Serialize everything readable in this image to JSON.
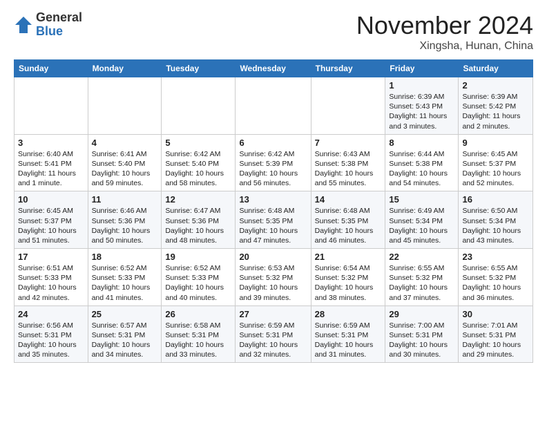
{
  "header": {
    "logo_general": "General",
    "logo_blue": "Blue",
    "month_title": "November 2024",
    "location": "Xingsha, Hunan, China"
  },
  "weekdays": [
    "Sunday",
    "Monday",
    "Tuesday",
    "Wednesday",
    "Thursday",
    "Friday",
    "Saturday"
  ],
  "weeks": [
    [
      {
        "day": "",
        "info": ""
      },
      {
        "day": "",
        "info": ""
      },
      {
        "day": "",
        "info": ""
      },
      {
        "day": "",
        "info": ""
      },
      {
        "day": "",
        "info": ""
      },
      {
        "day": "1",
        "info": "Sunrise: 6:39 AM\nSunset: 5:43 PM\nDaylight: 11 hours and 3 minutes."
      },
      {
        "day": "2",
        "info": "Sunrise: 6:39 AM\nSunset: 5:42 PM\nDaylight: 11 hours and 2 minutes."
      }
    ],
    [
      {
        "day": "3",
        "info": "Sunrise: 6:40 AM\nSunset: 5:41 PM\nDaylight: 11 hours and 1 minute."
      },
      {
        "day": "4",
        "info": "Sunrise: 6:41 AM\nSunset: 5:40 PM\nDaylight: 10 hours and 59 minutes."
      },
      {
        "day": "5",
        "info": "Sunrise: 6:42 AM\nSunset: 5:40 PM\nDaylight: 10 hours and 58 minutes."
      },
      {
        "day": "6",
        "info": "Sunrise: 6:42 AM\nSunset: 5:39 PM\nDaylight: 10 hours and 56 minutes."
      },
      {
        "day": "7",
        "info": "Sunrise: 6:43 AM\nSunset: 5:38 PM\nDaylight: 10 hours and 55 minutes."
      },
      {
        "day": "8",
        "info": "Sunrise: 6:44 AM\nSunset: 5:38 PM\nDaylight: 10 hours and 54 minutes."
      },
      {
        "day": "9",
        "info": "Sunrise: 6:45 AM\nSunset: 5:37 PM\nDaylight: 10 hours and 52 minutes."
      }
    ],
    [
      {
        "day": "10",
        "info": "Sunrise: 6:45 AM\nSunset: 5:37 PM\nDaylight: 10 hours and 51 minutes."
      },
      {
        "day": "11",
        "info": "Sunrise: 6:46 AM\nSunset: 5:36 PM\nDaylight: 10 hours and 50 minutes."
      },
      {
        "day": "12",
        "info": "Sunrise: 6:47 AM\nSunset: 5:36 PM\nDaylight: 10 hours and 48 minutes."
      },
      {
        "day": "13",
        "info": "Sunrise: 6:48 AM\nSunset: 5:35 PM\nDaylight: 10 hours and 47 minutes."
      },
      {
        "day": "14",
        "info": "Sunrise: 6:48 AM\nSunset: 5:35 PM\nDaylight: 10 hours and 46 minutes."
      },
      {
        "day": "15",
        "info": "Sunrise: 6:49 AM\nSunset: 5:34 PM\nDaylight: 10 hours and 45 minutes."
      },
      {
        "day": "16",
        "info": "Sunrise: 6:50 AM\nSunset: 5:34 PM\nDaylight: 10 hours and 43 minutes."
      }
    ],
    [
      {
        "day": "17",
        "info": "Sunrise: 6:51 AM\nSunset: 5:33 PM\nDaylight: 10 hours and 42 minutes."
      },
      {
        "day": "18",
        "info": "Sunrise: 6:52 AM\nSunset: 5:33 PM\nDaylight: 10 hours and 41 minutes."
      },
      {
        "day": "19",
        "info": "Sunrise: 6:52 AM\nSunset: 5:33 PM\nDaylight: 10 hours and 40 minutes."
      },
      {
        "day": "20",
        "info": "Sunrise: 6:53 AM\nSunset: 5:32 PM\nDaylight: 10 hours and 39 minutes."
      },
      {
        "day": "21",
        "info": "Sunrise: 6:54 AM\nSunset: 5:32 PM\nDaylight: 10 hours and 38 minutes."
      },
      {
        "day": "22",
        "info": "Sunrise: 6:55 AM\nSunset: 5:32 PM\nDaylight: 10 hours and 37 minutes."
      },
      {
        "day": "23",
        "info": "Sunrise: 6:55 AM\nSunset: 5:32 PM\nDaylight: 10 hours and 36 minutes."
      }
    ],
    [
      {
        "day": "24",
        "info": "Sunrise: 6:56 AM\nSunset: 5:31 PM\nDaylight: 10 hours and 35 minutes."
      },
      {
        "day": "25",
        "info": "Sunrise: 6:57 AM\nSunset: 5:31 PM\nDaylight: 10 hours and 34 minutes."
      },
      {
        "day": "26",
        "info": "Sunrise: 6:58 AM\nSunset: 5:31 PM\nDaylight: 10 hours and 33 minutes."
      },
      {
        "day": "27",
        "info": "Sunrise: 6:59 AM\nSunset: 5:31 PM\nDaylight: 10 hours and 32 minutes."
      },
      {
        "day": "28",
        "info": "Sunrise: 6:59 AM\nSunset: 5:31 PM\nDaylight: 10 hours and 31 minutes."
      },
      {
        "day": "29",
        "info": "Sunrise: 7:00 AM\nSunset: 5:31 PM\nDaylight: 10 hours and 30 minutes."
      },
      {
        "day": "30",
        "info": "Sunrise: 7:01 AM\nSunset: 5:31 PM\nDaylight: 10 hours and 29 minutes."
      }
    ]
  ]
}
